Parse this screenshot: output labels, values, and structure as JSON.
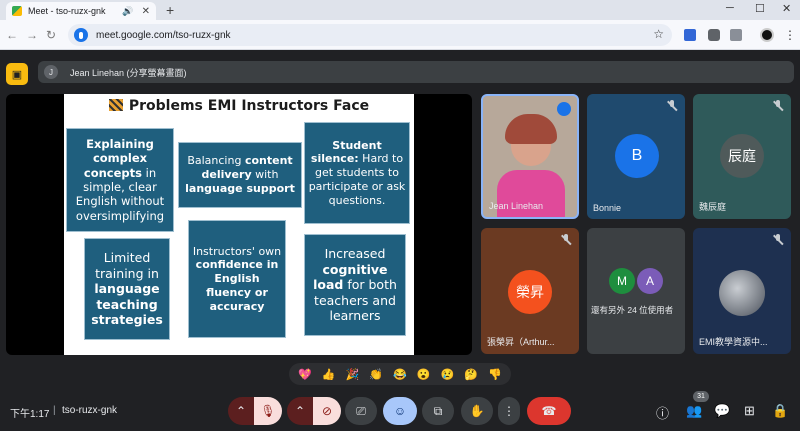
{
  "browser": {
    "tab_title": "Meet - tso-ruzx-gnk",
    "url": "meet.google.com/tso-ruzx-gnk"
  },
  "meet": {
    "presenter_label": "Jean Linehan (分享螢幕畫面)",
    "presenter_initial": "J",
    "slide": {
      "title": "Problems EMI Instructors Face",
      "boxes": [
        {
          "pre": "",
          "bold": "Explaining complex concepts",
          "post": " in simple, clear English without oversimplifying"
        },
        {
          "pre": "Balancing ",
          "bold": "content delivery",
          "post": " with "
        },
        {
          "pre": "",
          "bold": "Student silence:",
          "post": " Hard to get students to participate or ask questions."
        },
        {
          "pre": "Limited training in ",
          "bold": "language teaching strategies",
          "post": ""
        },
        {
          "pre": "Instructors' own ",
          "bold": "confidence in English fluency or accuracy",
          "post": ""
        },
        {
          "pre": "Increased ",
          "bold": "cognitive load",
          "post": " for both teachers and learners"
        }
      ],
      "box2_bold_tail": "language support"
    },
    "participants": [
      {
        "name": "Jean Linehan"
      },
      {
        "name": "Bonnie",
        "initial": "B"
      },
      {
        "name": "魏辰庭",
        "initial": "辰庭"
      },
      {
        "name": "張榮昇（Arthur...",
        "initial": "榮昇"
      },
      {
        "name": "還有另外 24 位使用者",
        "initials": [
          "M",
          "A"
        ]
      },
      {
        "name": "EMI教學資源中..."
      }
    ],
    "reactions": [
      "💖",
      "👍",
      "🎉",
      "👏",
      "😂",
      "😮",
      "😢",
      "🤔",
      "👎"
    ],
    "bottom": {
      "time": "下午1:17",
      "separator": "|",
      "meeting_code": "tso-ruzx-gnk",
      "participant_count": "31"
    }
  }
}
